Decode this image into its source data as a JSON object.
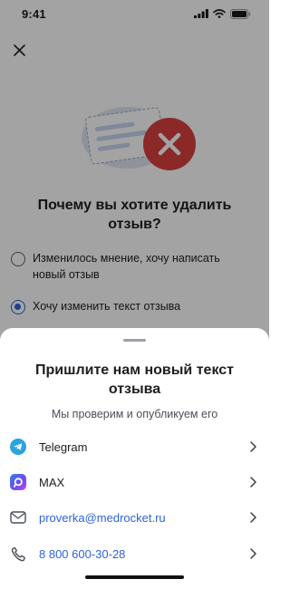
{
  "status_bar": {
    "time": "9:41",
    "icons": [
      "cellular-signal-icon",
      "wifi-icon",
      "battery-icon"
    ]
  },
  "background_screen": {
    "close_icon": "close-icon",
    "illustration": "review-delete-illustration",
    "title": "Почему вы хотите удалить отзыв?",
    "options": [
      {
        "label": "Изменилось мнение, хочу написать новый отзыв",
        "selected": false
      },
      {
        "label": "Хочу изменить текст отзыва",
        "selected": true
      }
    ]
  },
  "bottom_sheet": {
    "title": "Пришлите нам новый текст отзыва",
    "subtitle": "Мы проверим и опубликуем его",
    "contacts": [
      {
        "label": "Telegram",
        "icon": "telegram-icon"
      },
      {
        "label": "MAX",
        "icon": "max-app-icon"
      },
      {
        "label": "proverka@medrocket.ru",
        "icon": "mail-icon"
      },
      {
        "label": "8 800 600-30-28",
        "icon": "phone-icon"
      }
    ]
  },
  "colors": {
    "accent": "#2f63d6",
    "telegram": "#2aa3e0",
    "error_red": "#d94040",
    "overlay": "#000000"
  }
}
